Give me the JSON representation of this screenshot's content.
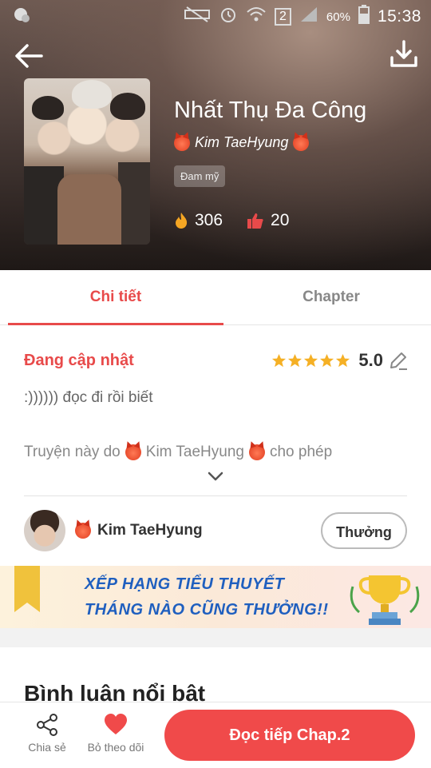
{
  "statusbar": {
    "battery_pct": "60%",
    "time": "15:38",
    "sim_badge": "2"
  },
  "book": {
    "title": "Nhất Thụ Đa Công",
    "author": "Kim TaeHyung",
    "tag": "Đam mỹ",
    "views": "306",
    "likes": "20"
  },
  "tabs": {
    "detail": "Chi tiết",
    "chapter": "Chapter"
  },
  "detail": {
    "status": "Đang cập nhật",
    "rating": "5.0",
    "description": ":)))))) đọc đi rồi biết",
    "license_prefix": "Truyện này do",
    "license_author": "Kim TaeHyung",
    "license_suffix": "cho phép"
  },
  "uploader": {
    "name": "Kim TaeHyung",
    "reward_label": "Thưởng"
  },
  "banner": {
    "line1": "XẾP HẠNG TIỂU THUYẾT",
    "line2": "THÁNG NÀO CŨNG THƯỞNG!!"
  },
  "section": {
    "title": "Bình luận nổi bật"
  },
  "bottombar": {
    "share": "Chia sẻ",
    "unfollow": "Bỏ theo dõi",
    "read": "Đọc tiếp Chap.2"
  },
  "colors": {
    "accent": "#f04a4a",
    "accent_text": "#e84a4a",
    "banner_blue": "#1f5fbf",
    "star": "#f5b025"
  },
  "icons": [
    "back-arrow-icon",
    "download-icon",
    "fire-icon",
    "thumbs-up-icon",
    "star-icon",
    "edit-icon",
    "chevron-down-icon",
    "share-icon",
    "heart-icon",
    "trophy-icon",
    "ribbon-icon",
    "devil-emoji-icon"
  ]
}
